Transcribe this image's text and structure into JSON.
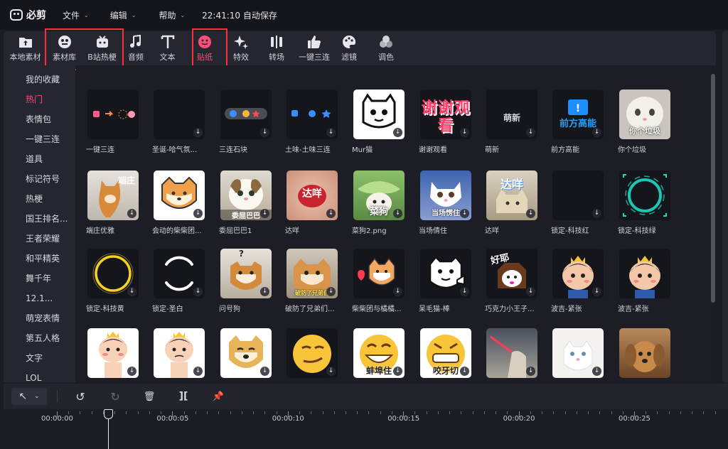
{
  "menubar": {
    "app_name": "必剪",
    "menus": [
      {
        "label": "文件",
        "chev": "⌄"
      },
      {
        "label": "编辑",
        "chev": "⌄"
      },
      {
        "label": "帮助",
        "chev": "⌄"
      }
    ],
    "autosave": "22:41:10 自动保存"
  },
  "toolbar": {
    "active_color": "#ff4d7a",
    "tools": [
      {
        "label": "本地素材",
        "icon": "folder-upload-icon"
      },
      {
        "label": "素材库",
        "icon": "material-library-icon"
      },
      {
        "label": "B站热梗",
        "icon": "bilibili-tv-icon"
      },
      {
        "label": "音频",
        "icon": "music-note-icon"
      },
      {
        "label": "文本",
        "icon": "text-t-icon"
      },
      {
        "label": "贴纸",
        "icon": "sticker-icon",
        "active": true
      },
      {
        "label": "特效",
        "icon": "sparkle-effect-icon"
      },
      {
        "label": "转场",
        "icon": "transition-icon"
      },
      {
        "label": "一键三连",
        "icon": "thumbs-up-icon"
      },
      {
        "label": "滤镜",
        "icon": "palette-filter-icon"
      },
      {
        "label": "调色",
        "icon": "color-circles-icon"
      }
    ]
  },
  "sidebar": {
    "items": [
      {
        "label": "我的收藏"
      },
      {
        "label": "热门",
        "active": true
      },
      {
        "label": "表情包"
      },
      {
        "label": "一键三连"
      },
      {
        "label": "道具"
      },
      {
        "label": "标记符号"
      },
      {
        "label": "热梗"
      },
      {
        "label": "国王排名..."
      },
      {
        "label": "王者荣耀"
      },
      {
        "label": "和平精英"
      },
      {
        "label": "舞千年"
      },
      {
        "label": "12.1..."
      },
      {
        "label": "萌宠表情"
      },
      {
        "label": "第五人格"
      },
      {
        "label": "文字"
      },
      {
        "label": "LOL"
      }
    ]
  },
  "stickers": {
    "download_glyph": "↓",
    "rows": [
      [
        {
          "caption": "一键三连",
          "style": "sanlian",
          "dl": false
        },
        {
          "caption": "圣诞-哈气氛...",
          "style": "blank",
          "dl": true
        },
        {
          "caption": "三连石块",
          "style": "stones",
          "dl": true
        },
        {
          "caption": "土味-土味三连",
          "style": "tuwei",
          "dl": true
        },
        {
          "caption": "Mur猫",
          "style": "murcat",
          "dl": true
        },
        {
          "caption": "谢谢观看",
          "style": "thanks",
          "overlay": "谢谢观看",
          "dl": true
        },
        {
          "caption": "萌新",
          "style": "mengxin",
          "overlay": "萌新",
          "dl": true
        },
        {
          "caption": "前方高能",
          "style": "qianfang",
          "overlay": "前方高能",
          "dl": true
        },
        {
          "caption": "你个垃圾",
          "style": "trashcat",
          "overlay": "你个垃圾",
          "dl": false
        }
      ],
      [
        {
          "caption": "端庄优雅",
          "style": "shiba-photo",
          "overlay": "端庄",
          "dl": true
        },
        {
          "caption": "会动的柴柴团...",
          "style": "shiba-cartoon",
          "dl": true
        },
        {
          "caption": "委屈巴巴1",
          "style": "cat-photo",
          "overlay": "委屈巴巴",
          "dl": true
        },
        {
          "caption": "达咩",
          "style": "dame-red",
          "overlay": "达咩",
          "dl": true
        },
        {
          "caption": "菜狗2.png",
          "style": "caigou",
          "overlay": "菜狗",
          "dl": true
        },
        {
          "caption": "当场倩住",
          "style": "kitten",
          "overlay": "当场愣住",
          "dl": true
        },
        {
          "caption": "达咩",
          "style": "dame-cat",
          "overlay": "达咩",
          "dl": true
        },
        {
          "caption": "锁定-科技红",
          "style": "blank",
          "dl": true
        },
        {
          "caption": "锁定-科技绿",
          "style": "tech-green",
          "dl": false
        }
      ],
      [
        {
          "caption": "锁定-科技黄",
          "style": "ring-yellow",
          "dl": true
        },
        {
          "caption": "锁定-圣白",
          "style": "ring-white",
          "dl": true
        },
        {
          "caption": "问号狗",
          "style": "question-dog",
          "overlay": "?",
          "dl": true
        },
        {
          "caption": "破防了兄弟们...",
          "style": "pofang",
          "overlay": "破防了兄弟们",
          "dl": true
        },
        {
          "caption": "柴柴团与橘橘...",
          "style": "shiba-heart",
          "dl": true
        },
        {
          "caption": "呆毛猫-棒",
          "style": "daimao",
          "dl": true
        },
        {
          "caption": "巧克力小王子...",
          "style": "choco",
          "overlay": "好耶",
          "dl": true
        },
        {
          "caption": "波吉-紧张",
          "style": "bojji",
          "dl": true
        },
        {
          "caption": "波吉-紧张",
          "style": "bojji",
          "dl": false
        }
      ],
      [
        {
          "caption": "",
          "style": "bojji-blush",
          "dl": true
        },
        {
          "caption": "",
          "style": "bojji-cry",
          "dl": true
        },
        {
          "caption": "",
          "style": "doge",
          "dl": true
        },
        {
          "caption": "",
          "style": "smirk",
          "dl": true
        },
        {
          "caption": "",
          "style": "grin",
          "overlay": "蚌埠住",
          "dl": true
        },
        {
          "caption": "",
          "style": "grit",
          "overlay": "咬牙切",
          "dl": true
        },
        {
          "caption": "",
          "style": "lightsaber",
          "dl": true
        },
        {
          "caption": "",
          "style": "cat-white",
          "dl": true
        },
        {
          "caption": "",
          "style": "puppy",
          "dl": false
        }
      ]
    ]
  },
  "timeline": {
    "tools": [
      {
        "icon": "cursor-select-icon",
        "glyph": "↖"
      },
      {
        "icon": "undo-icon",
        "glyph": "↺"
      },
      {
        "icon": "redo-icon",
        "glyph": "↻"
      },
      {
        "icon": "delete-icon",
        "glyph": "🗑"
      },
      {
        "icon": "split-icon",
        "glyph": "]["
      },
      {
        "icon": "pin-icon",
        "glyph": "📌"
      }
    ],
    "labels": [
      "00:00:00",
      "00:00:05",
      "00:00:10",
      "00:00:15",
      "00:00:20",
      "00:00:25"
    ]
  }
}
